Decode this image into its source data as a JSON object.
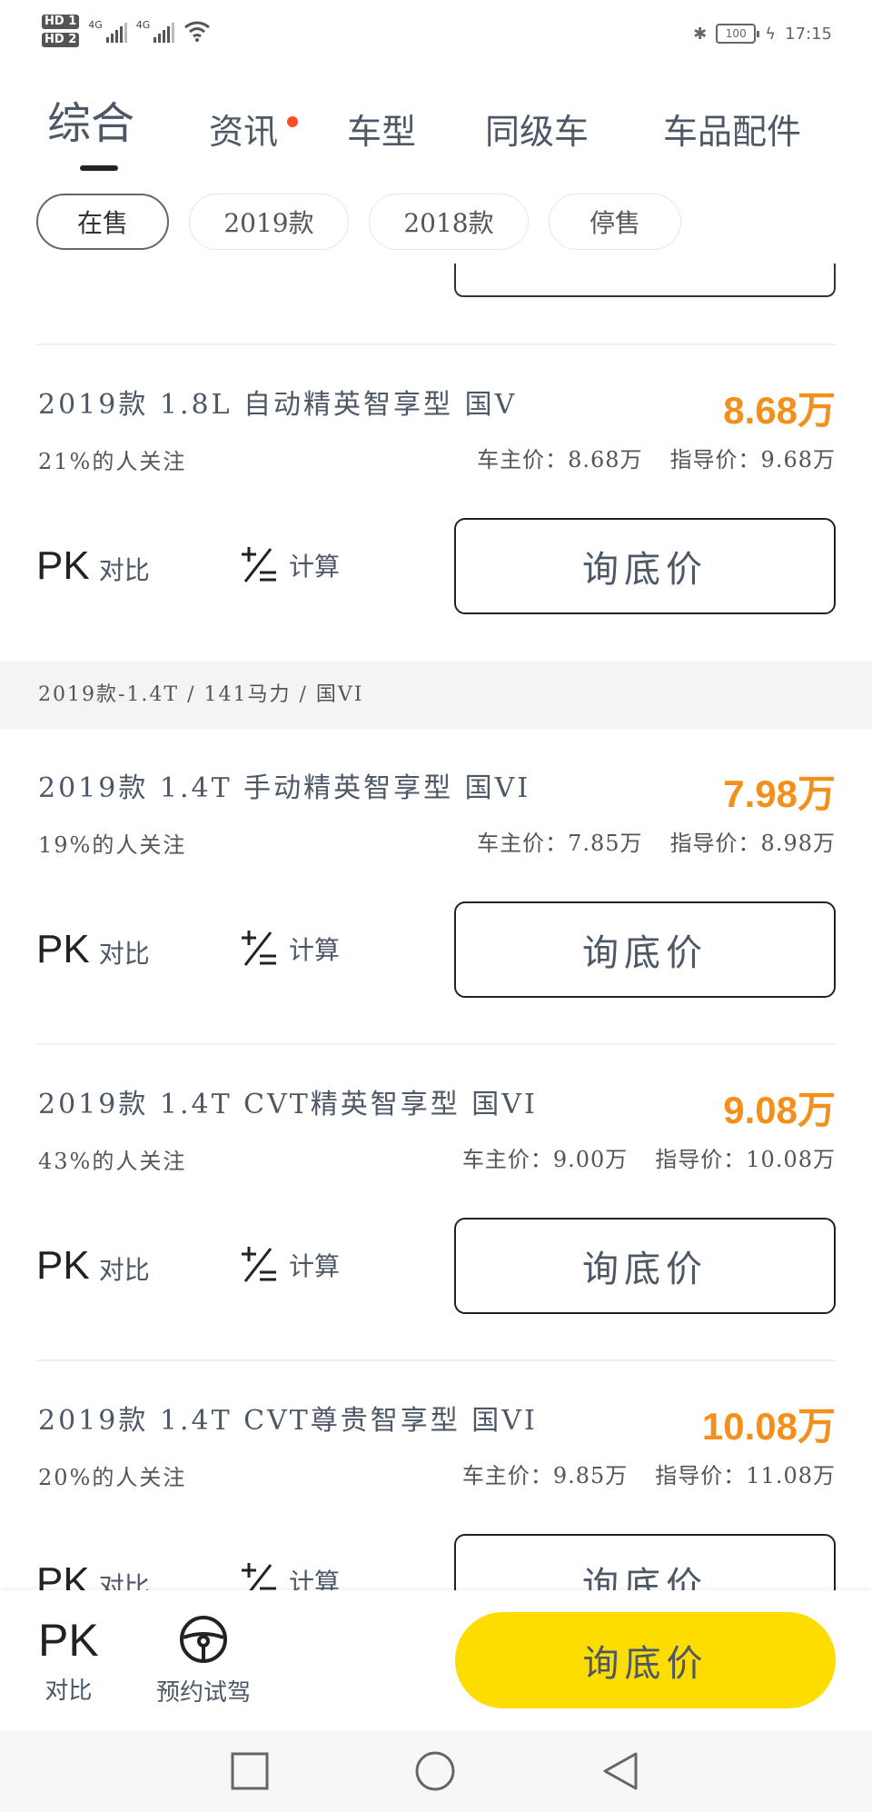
{
  "status_bar": {
    "sim1": "HD 1",
    "sim2": "HD 2",
    "net1": "4G",
    "net2": "4G",
    "battery": "100",
    "time": "17:15"
  },
  "tabs": [
    {
      "label": "综合",
      "active": true
    },
    {
      "label": "资讯",
      "has_dot": true
    },
    {
      "label": "车型"
    },
    {
      "label": "同级车"
    },
    {
      "label": "车品配件"
    }
  ],
  "filters": [
    {
      "label": "在售",
      "active": true
    },
    {
      "label": "2019款"
    },
    {
      "label": "2018款"
    },
    {
      "label": "停售"
    }
  ],
  "section_header": "2019款-1.4T / 141马力 / 国VI",
  "items": [
    {
      "name": "2019款 1.8L 自动精英智享型 国V",
      "price": "8.68万",
      "attention": "21%的人关注",
      "owner_price": "车主价：8.68万",
      "guide_price": "指导价：9.68万"
    },
    {
      "name": "2019款 1.4T 手动精英智享型 国VI",
      "price": "7.98万",
      "attention": "19%的人关注",
      "owner_price": "车主价：7.85万",
      "guide_price": "指导价：8.98万"
    },
    {
      "name": "2019款 1.4T CVT精英智享型 国VI",
      "price": "9.08万",
      "attention": "43%的人关注",
      "owner_price": "车主价：9.00万",
      "guide_price": "指导价：10.08万"
    },
    {
      "name": "2019款 1.4T CVT尊贵智享型 国VI",
      "price": "10.08万",
      "attention": "20%的人关注",
      "owner_price": "车主价：9.85万",
      "guide_price": "指导价：11.08万"
    }
  ],
  "actions": {
    "pk": "PK",
    "compare": "对比",
    "calc": "计算",
    "ask": "询底价"
  },
  "bottom": {
    "pk": "PK",
    "compare": "对比",
    "test_drive": "预约试驾",
    "ask": "询底价"
  },
  "colors": {
    "price": "#f3901b",
    "accent_yellow": "#fddc00",
    "tab_dot": "#ff4b2b"
  }
}
